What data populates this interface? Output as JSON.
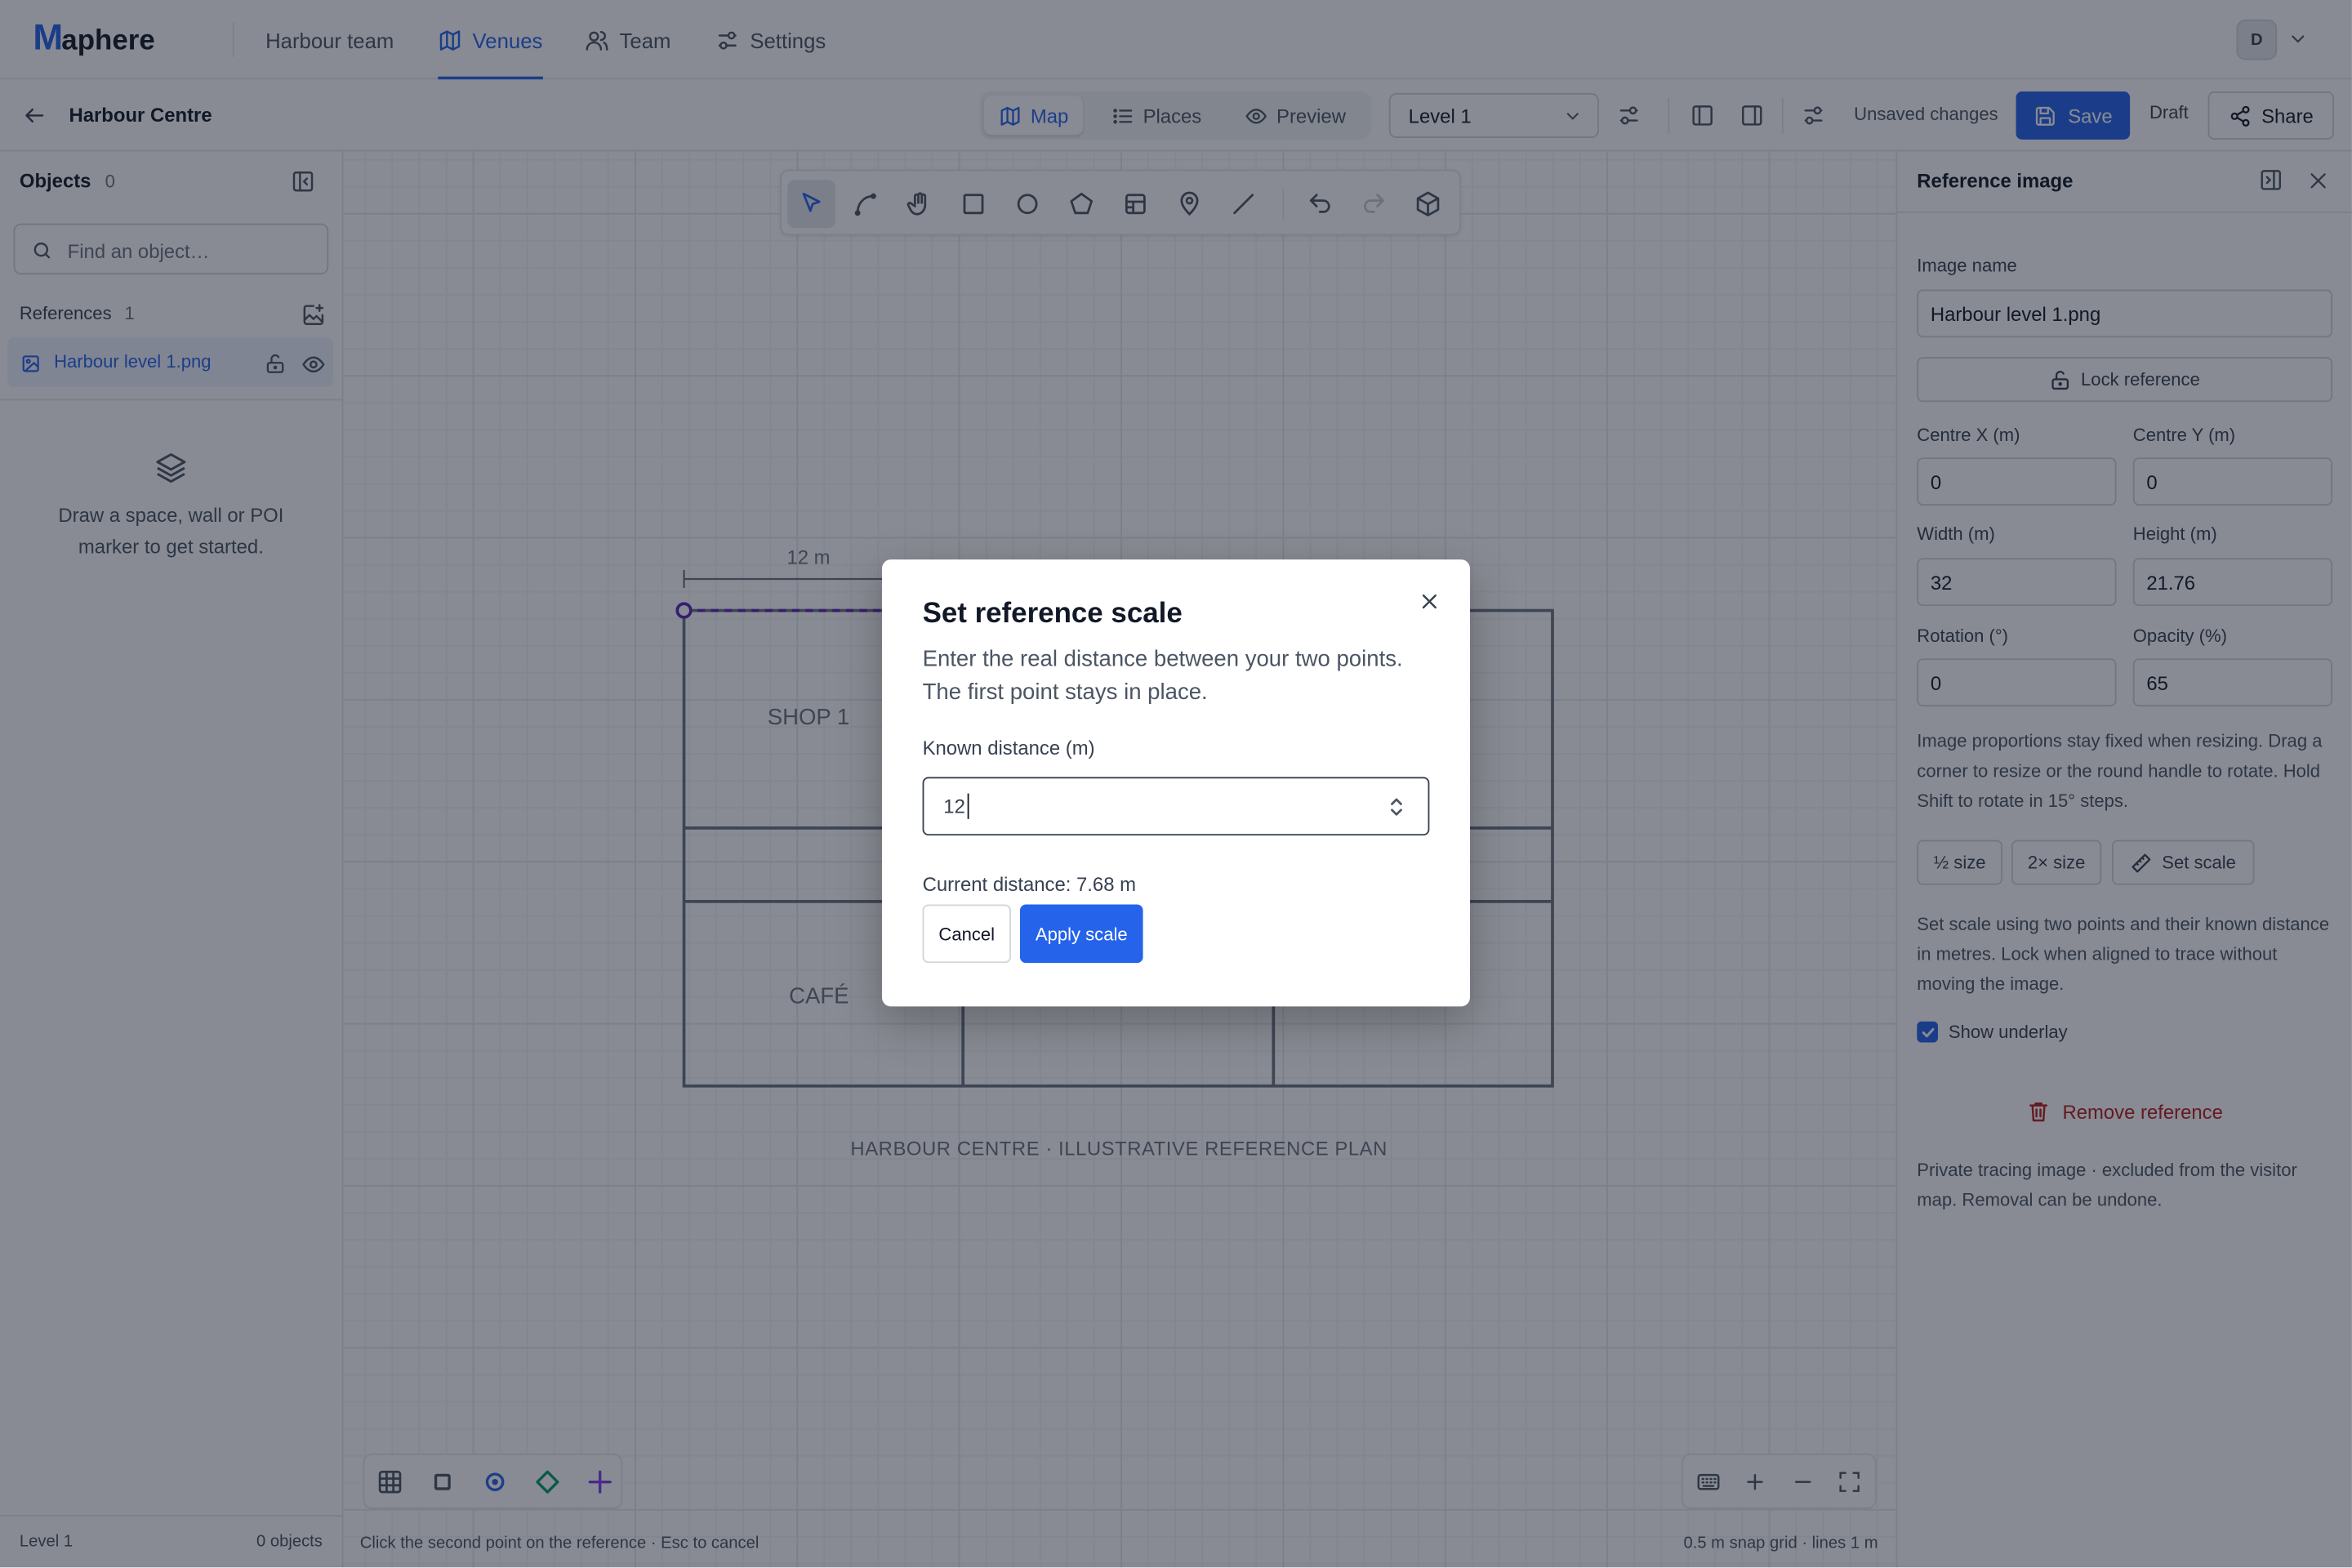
{
  "app": {
    "logo_mark": "M",
    "logo_rest": "aphere"
  },
  "topnav": {
    "items": [
      {
        "label": "Harbour team"
      },
      {
        "label": "Venues"
      },
      {
        "label": "Team"
      },
      {
        "label": "Settings"
      }
    ],
    "avatar_initial": "D"
  },
  "toolbar": {
    "venue_title": "Harbour Centre",
    "views": [
      "Map",
      "Places",
      "Preview"
    ],
    "level": "Level 1",
    "unsaved": "Unsaved changes",
    "save_label": "Save",
    "draft_label": "Draft",
    "share_label": "Share"
  },
  "left": {
    "objects_title": "Objects",
    "objects_count": "0",
    "search_placeholder": "Find an object…",
    "references_title": "References",
    "references_count": "1",
    "reference_name": "Harbour level 1.png",
    "empty_text": "Draw a space, wall or POI marker to get started.",
    "footer_level": "Level 1",
    "footer_objects": "0 objects"
  },
  "canvas": {
    "measure_label": "12 m",
    "rooms": [
      "SHOP 1",
      "CAFÉ"
    ],
    "plan_caption": "HARBOUR CENTRE · ILLUSTRATIVE REFERENCE PLAN",
    "status_left": "Click the second point on the reference · Esc to cancel",
    "status_right": "0.5 m snap grid · lines 1 m"
  },
  "right": {
    "title": "Reference image",
    "image_name_label": "Image name",
    "image_name_value": "Harbour level 1.png",
    "lock_label": "Lock reference",
    "centre_x_label": "Centre X (m)",
    "centre_x_value": "0",
    "centre_y_label": "Centre Y (m)",
    "centre_y_value": "0",
    "width_label": "Width (m)",
    "width_value": "32",
    "height_label": "Height (m)",
    "height_value": "21.76",
    "rotation_label": "Rotation (°)",
    "rotation_value": "0",
    "opacity_label": "Opacity (%)",
    "opacity_value": "65",
    "help_resize": "Image proportions stay fixed when resizing. Drag a corner to resize or the round handle to rotate. Hold Shift to rotate in 15° steps.",
    "half_size_label": "½ size",
    "double_size_label": "2× size",
    "set_scale_label": "Set scale",
    "help_scale": "Set scale using two points and their known distance in metres. Lock when aligned to trace without moving the image.",
    "show_underlay_label": "Show underlay",
    "show_underlay_checked": true,
    "remove_label": "Remove reference",
    "private_note": "Private tracing image · excluded from the visitor map. Removal can be undone."
  },
  "modal": {
    "title": "Set reference scale",
    "description": "Enter the real distance between your two points. The first point stays in place.",
    "field_label": "Known distance (m)",
    "field_value": "12",
    "current_distance": "Current distance: 7.68 m",
    "cancel_label": "Cancel",
    "apply_label": "Apply scale"
  },
  "colors": {
    "accent": "#2563eb",
    "danger": "#b91c1c",
    "overlay": "rgba(17,24,39,0.5)",
    "layer_square": "#4b5563",
    "layer_circle": "#2563eb",
    "layer_diamond": "#059669",
    "layer_plus": "#7c3aed"
  },
  "icons": {
    "topnav": [
      "map-icon",
      "users-icon",
      "sliders-icon",
      "chevron-down-icon"
    ],
    "tools": [
      "select-icon",
      "curve-icon",
      "hand-icon",
      "rectangle-icon",
      "circle-icon",
      "pentagon-icon",
      "grid-room-icon",
      "pin-icon",
      "line-icon",
      "undo-icon",
      "redo-icon",
      "cube-icon"
    ],
    "layers": [
      "grid-icon",
      "square-icon",
      "circle-dot-icon",
      "diamond-icon",
      "plus-icon"
    ],
    "zoom": [
      "keyboard-icon",
      "zoom-in-icon",
      "zoom-out-icon",
      "fullscreen-icon"
    ]
  }
}
